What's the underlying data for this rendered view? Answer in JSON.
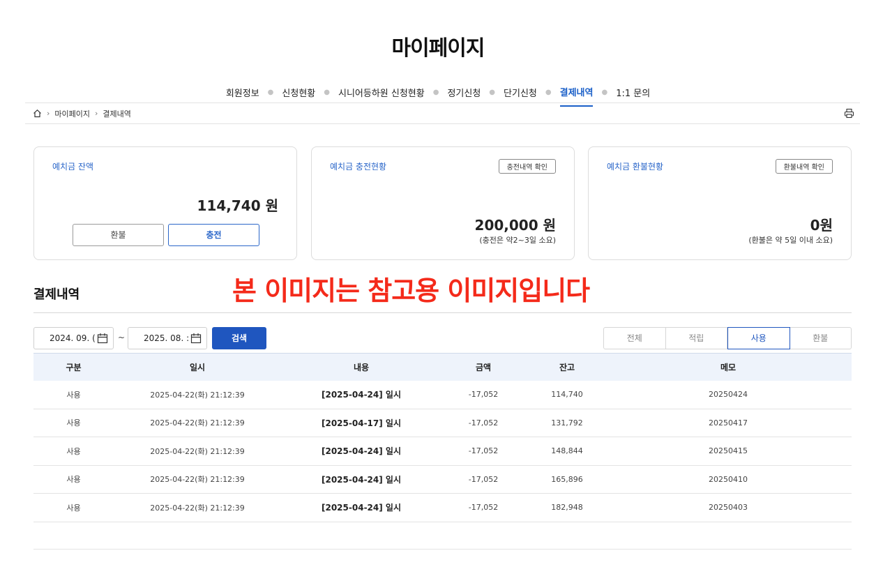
{
  "page": {
    "title": "마이페이지"
  },
  "tabs": [
    {
      "label": "회원정보",
      "active": false
    },
    {
      "label": "신청현황",
      "active": false
    },
    {
      "label": "시니어등하원 신청현황",
      "active": false
    },
    {
      "label": "정기신청",
      "active": false
    },
    {
      "label": "단기신청",
      "active": false
    },
    {
      "label": "결제내역",
      "active": true
    },
    {
      "label": "1:1 문의",
      "active": false
    }
  ],
  "breadcrumb": {
    "home_icon": "home-icon",
    "items": [
      "마이페이지",
      "결제내역"
    ],
    "print_icon": "printer-icon"
  },
  "cards": {
    "balance": {
      "title": "예치금 잔액",
      "amount": "114,740 원",
      "refund_label": "환불",
      "charge_label": "충전"
    },
    "charge": {
      "title": "예치금 충전현황",
      "link_label": "충전내역 확인",
      "amount": "200,000 원",
      "note": "(충전은 약2~3일 소요)"
    },
    "refund": {
      "title": "예치금 환불현황",
      "link_label": "환불내역 확인",
      "amount": "0원",
      "note": "(환불은 약 5일 이내 소요)"
    }
  },
  "section": {
    "title": "결제내역",
    "watermark": "본 이미지는 참고용 이미지입니다"
  },
  "search": {
    "start_date": "2024. 09. (",
    "end_date": "2025. 08. :",
    "separator": "~",
    "button_label": "검색",
    "calendar_icon": "calendar-icon"
  },
  "filters": [
    {
      "label": "전체",
      "active": false
    },
    {
      "label": "적립",
      "active": false
    },
    {
      "label": "사용",
      "active": true
    },
    {
      "label": "환불",
      "active": false
    }
  ],
  "table": {
    "headers": [
      "구분",
      "일시",
      "내용",
      "금액",
      "잔고",
      "메모"
    ],
    "rows": [
      [
        "사용",
        "2025-04-22(화) 21:12:39",
        "[2025-04-24] 일시",
        "-17,052",
        "114,740",
        "20250424"
      ],
      [
        "사용",
        "2025-04-22(화) 21:12:39",
        "[2025-04-17] 일시",
        "-17,052",
        "131,792",
        "20250417"
      ],
      [
        "사용",
        "2025-04-22(화) 21:12:39",
        "[2025-04-24] 일시",
        "-17,052",
        "148,844",
        "20250415"
      ],
      [
        "사용",
        "2025-04-22(화) 21:12:39",
        "[2025-04-24] 일시",
        "-17,052",
        "165,896",
        "20250410"
      ],
      [
        "사용",
        "2025-04-22(화) 21:12:39",
        "[2025-04-24] 일시",
        "-17,052",
        "182,948",
        "20250403"
      ]
    ]
  }
}
